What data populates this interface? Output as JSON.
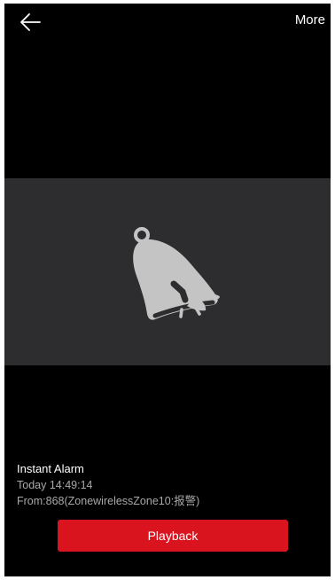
{
  "header": {
    "back_icon": "arrow-left-icon",
    "more_label": "More"
  },
  "preview": {
    "icon": "bell-icon"
  },
  "alarm": {
    "title": "Instant Alarm",
    "time": "Today 14:49:14",
    "source": "From:868(ZonewirelessZone10:报警)"
  },
  "actions": {
    "playback_label": "Playback"
  },
  "colors": {
    "background": "#000000",
    "panel": "#2d2d2f",
    "primary_button": "#d9141e",
    "icon": "#c4c4c4",
    "secondary_text": "#a9a9a9"
  }
}
